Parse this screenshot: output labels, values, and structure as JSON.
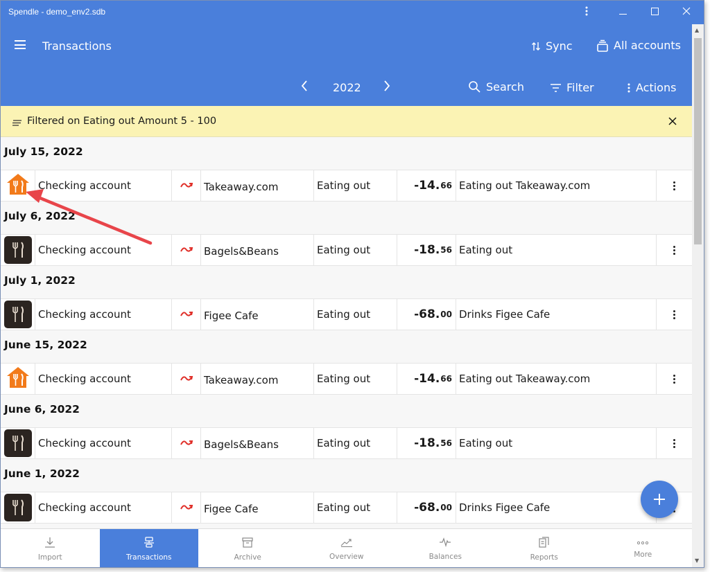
{
  "window": {
    "title": "Spendle - demo_env2.sdb",
    "menu_icon": "kebab-vertical-icon",
    "minimize_icon": "minimize-icon",
    "maximize_icon": "maximize-icon",
    "close_icon": "close-icon"
  },
  "header": {
    "page_title": "Transactions",
    "sync_label": "Sync",
    "accounts_label": "All accounts",
    "year": "2022",
    "search_label": "Search",
    "filter_label": "Filter",
    "actions_label": "Actions"
  },
  "filter_banner": {
    "text": "Filtered on Eating out Amount 5 - 100"
  },
  "groups": [
    {
      "date": "July 15, 2022",
      "transactions": [
        {
          "icon": "takeaway-house-icon",
          "account": "Checking account",
          "payee": "Takeaway.com",
          "category": "Eating out",
          "amount_int": "-14.",
          "amount_dec": "66",
          "memo": "Eating out Takeaway.com"
        }
      ]
    },
    {
      "date": "July 6, 2022",
      "transactions": [
        {
          "icon": "fork-knife-icon",
          "account": "Checking account",
          "payee": "Bagels&Beans",
          "category": "Eating out",
          "amount_int": "-18.",
          "amount_dec": "56",
          "memo": "Eating out"
        }
      ]
    },
    {
      "date": "July 1, 2022",
      "transactions": [
        {
          "icon": "fork-knife-icon",
          "account": "Checking account",
          "payee": "Figee Cafe",
          "category": "Eating out",
          "amount_int": "-68.",
          "amount_dec": "00",
          "memo": "Drinks Figee Cafe"
        }
      ]
    },
    {
      "date": "June 15, 2022",
      "transactions": [
        {
          "icon": "takeaway-house-icon",
          "account": "Checking account",
          "payee": "Takeaway.com",
          "category": "Eating out",
          "amount_int": "-14.",
          "amount_dec": "66",
          "memo": "Eating out Takeaway.com"
        }
      ]
    },
    {
      "date": "June 6, 2022",
      "transactions": [
        {
          "icon": "fork-knife-icon",
          "account": "Checking account",
          "payee": "Bagels&Beans",
          "category": "Eating out",
          "amount_int": "-18.",
          "amount_dec": "56",
          "memo": "Eating out"
        }
      ]
    },
    {
      "date": "June 1, 2022",
      "transactions": [
        {
          "icon": "fork-knife-icon",
          "account": "Checking account",
          "payee": "Figee Cafe",
          "category": "Eating out",
          "amount_int": "-68.",
          "amount_dec": "00",
          "memo": "Drinks Figee Cafe"
        }
      ]
    }
  ],
  "bottom_nav": {
    "items": [
      {
        "label": "Import",
        "icon": "download-icon",
        "active": false
      },
      {
        "label": "Transactions",
        "icon": "transactions-icon",
        "active": true
      },
      {
        "label": "Archive",
        "icon": "archive-icon",
        "active": false
      },
      {
        "label": "Overview",
        "icon": "trend-icon",
        "active": false
      },
      {
        "label": "Balances",
        "icon": "pulse-icon",
        "active": false
      },
      {
        "label": "Reports",
        "icon": "reports-icon",
        "active": false
      },
      {
        "label": "More",
        "icon": "more-dots-icon",
        "active": false
      }
    ]
  },
  "colors": {
    "primary": "#4a7fdb",
    "filter_banner_bg": "#fbf3b4",
    "transfer_icon": "#e0302a",
    "takeaway_orange": "#f27a1a",
    "category_dark": "#2b2420",
    "annotation_arrow": "#e8454a"
  },
  "fab": {
    "icon": "plus-icon"
  }
}
